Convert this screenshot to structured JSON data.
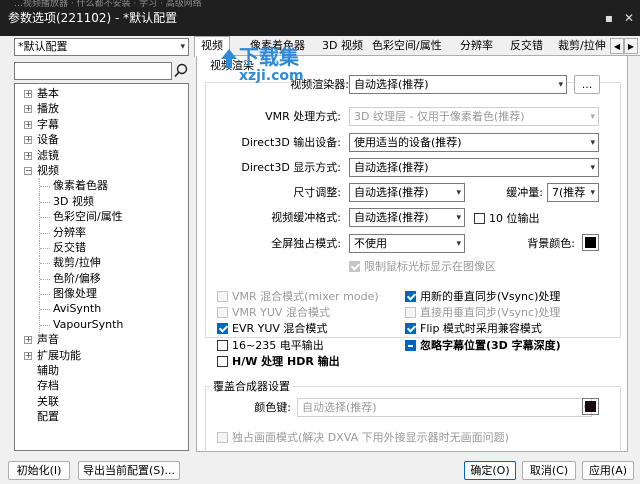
{
  "window": {
    "ghost_text": "…视频播放器  ·  什么都不安装  ·  学习  ·  高级网络",
    "title": "参数选项(221102) - *默认配置",
    "pin_glyph": "▪",
    "close_glyph": "✕"
  },
  "sidebar": {
    "profile": "*默认配置",
    "search_placeholder": "",
    "tree": [
      {
        "label": "基本",
        "expander": "+"
      },
      {
        "label": "播放",
        "expander": "+"
      },
      {
        "label": "字幕",
        "expander": "+"
      },
      {
        "label": "设备",
        "expander": "+"
      },
      {
        "label": "滤镜",
        "expander": "+"
      },
      {
        "label": "视频",
        "expander": "−"
      },
      {
        "label": "像素着色器",
        "child": true
      },
      {
        "label": "3D 视频",
        "child": true
      },
      {
        "label": "色彩空间/属性",
        "child": true
      },
      {
        "label": "分辨率",
        "child": true
      },
      {
        "label": "反交错",
        "child": true
      },
      {
        "label": "裁剪/拉伸",
        "child": true
      },
      {
        "label": "色阶/偏移",
        "child": true
      },
      {
        "label": "图像处理",
        "child": true
      },
      {
        "label": "AviSynth",
        "child": true
      },
      {
        "label": "VapourSynth",
        "child": true
      },
      {
        "label": "声音",
        "expander": "+"
      },
      {
        "label": "扩展功能",
        "expander": "+"
      },
      {
        "label": "辅助"
      },
      {
        "label": "存档"
      },
      {
        "label": "关联"
      },
      {
        "label": "配置"
      }
    ]
  },
  "tabs": [
    {
      "label": "视频",
      "active": true
    },
    {
      "label": "像素着色器"
    },
    {
      "label": "3D 视频"
    },
    {
      "label": "色彩空间/属性"
    },
    {
      "label": "分辨率"
    },
    {
      "label": "反交错"
    },
    {
      "label": "裁剪/拉伸"
    }
  ],
  "tab_scroll": {
    "left": "◀",
    "right": "▶"
  },
  "watermark": {
    "top": "下载集",
    "bottom": "xzji.com"
  },
  "video": {
    "group_title": "视频渲染",
    "renderer_label": "视频渲染器:",
    "renderer_value": "自动选择(推荐)",
    "renderer_more": "...",
    "vmr_label": "VMR 处理方式:",
    "vmr_value": "3D 纹理层 - 仅用于像素着色(推荐)",
    "d3d_device_label": "Direct3D 输出设备:",
    "d3d_device_value": "使用适当的设备(推荐)",
    "d3d_display_label": "Direct3D 显示方式:",
    "d3d_display_value": "自动选择(推荐)",
    "size_label": "尺寸调整:",
    "size_value": "自动选择(推荐)",
    "buffer_label": "缓冲量:",
    "buffer_value": "7(推荐",
    "format_label": "视频缓冲格式:",
    "format_value": "自动选择(推荐)",
    "tenbit_label": "10 位输出",
    "fullscreen_label": "全屏独占模式:",
    "fullscreen_value": "不使用",
    "bgcolor_label": "背景颜色:",
    "bgcolor": "#000000",
    "limit_cursor_label": "限制鼠标光标显示在图像区"
  },
  "options": {
    "left": [
      {
        "label": "VMR 混合模式(mixer mode)",
        "state": "off",
        "disabled": true
      },
      {
        "label": "VMR YUV 混合模式",
        "state": "off",
        "disabled": true
      },
      {
        "label": "EVR YUV 混合模式",
        "state": "on"
      },
      {
        "label": "16~235 电平输出",
        "state": "off"
      },
      {
        "label": "H/W 处理 HDR 输出",
        "state": "off",
        "bold": true
      }
    ],
    "right": [
      {
        "label": "用新的垂直同步(Vsync)处理",
        "state": "on"
      },
      {
        "label": "直接用垂直同步(Vsync)处理",
        "state": "off",
        "disabled": true
      },
      {
        "label": "Flip 模式时采用兼容模式",
        "state": "on"
      },
      {
        "label": "忽略字幕位置(3D 字幕深度)",
        "state": "ind",
        "bold": true
      }
    ]
  },
  "overlay": {
    "group_title": "覆盖合成器设置",
    "color_key_label": "颜色键:",
    "color_key_value": "自动选择(推荐)",
    "color_key_color": "#1a0a14",
    "exclusive_label": "独占画面模式(解决 DXVA 下用外接显示器时无画面问题)"
  },
  "footer": {
    "init": "初始化(I)",
    "export": "导出当前配置(S)...",
    "ok": "确定(O)",
    "cancel": "取消(C)",
    "apply": "应用(A)",
    "caret": "▾"
  },
  "colors": {
    "accent": "#0067c0",
    "titlebar": "#1f1f1f",
    "watermark": "#2f8ad8"
  }
}
